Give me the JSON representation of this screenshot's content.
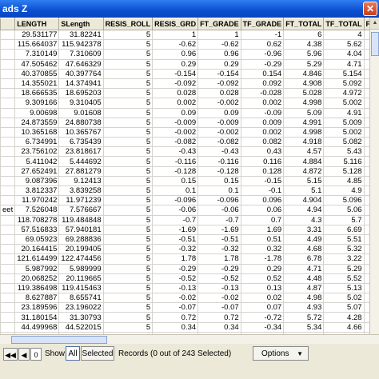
{
  "window": {
    "title": "ads Z",
    "close_glyph": "✕"
  },
  "table": {
    "columns": [
      "",
      "LENGTH",
      "SLength",
      "RESIS_ROLL",
      "RESIS_GRD",
      "FT_GRADE",
      "TF_GRADE",
      "FT_TOTAL",
      "TF_TOTAL",
      "F"
    ],
    "rows": [
      [
        "",
        "29.531177",
        "31.82241",
        "5",
        "1",
        "1",
        "-1",
        "6",
        "4",
        ""
      ],
      [
        "",
        "115.664037",
        "115.942378",
        "5",
        "-0.62",
        "-0.62",
        "0.62",
        "4.38",
        "5.62",
        ""
      ],
      [
        "",
        "7.310149",
        "7.310609",
        "5",
        "0.96",
        "0.96",
        "-0.96",
        "5.96",
        "4.04",
        ""
      ],
      [
        "",
        "47.505462",
        "47.646329",
        "5",
        "0.29",
        "0.29",
        "-0.29",
        "5.29",
        "4.71",
        ""
      ],
      [
        "",
        "40.370855",
        "40.397764",
        "5",
        "-0.154",
        "-0.154",
        "0.154",
        "4.846",
        "5.154",
        ""
      ],
      [
        "",
        "14.355021",
        "14.374941",
        "5",
        "-0.092",
        "-0.092",
        "0.092",
        "4.908",
        "5.092",
        ""
      ],
      [
        "",
        "18.666535",
        "18.695203",
        "5",
        "0.028",
        "0.028",
        "-0.028",
        "5.028",
        "4.972",
        ""
      ],
      [
        "",
        "9.309166",
        "9.310405",
        "5",
        "0.002",
        "-0.002",
        "0.002",
        "4.998",
        "5.002",
        ""
      ],
      [
        "",
        "9.00698",
        "9.01608",
        "5",
        "0.09",
        "0.09",
        "-0.09",
        "5.09",
        "4.91",
        ""
      ],
      [
        "",
        "24.873559",
        "24.880738",
        "5",
        "-0.009",
        "-0.009",
        "0.009",
        "4.991",
        "5.009",
        ""
      ],
      [
        "",
        "10.365168",
        "10.365767",
        "5",
        "-0.002",
        "-0.002",
        "0.002",
        "4.998",
        "5.002",
        ""
      ],
      [
        "",
        "6.734991",
        "6.735439",
        "5",
        "-0.082",
        "-0.082",
        "0.082",
        "4.918",
        "5.082",
        ""
      ],
      [
        "",
        "23.756102",
        "23.818617",
        "5",
        "-0.43",
        "-0.43",
        "0.43",
        "4.57",
        "5.43",
        ""
      ],
      [
        "",
        "5.411042",
        "5.444692",
        "5",
        "-0.116",
        "-0.116",
        "0.116",
        "4.884",
        "5.116",
        ""
      ],
      [
        "",
        "27.652491",
        "27.881279",
        "5",
        "-0.128",
        "-0.128",
        "0.128",
        "4.872",
        "5.128",
        ""
      ],
      [
        "",
        "9.087396",
        "9.12413",
        "5",
        "0.15",
        "0.15",
        "-0.15",
        "5.15",
        "4.85",
        ""
      ],
      [
        "",
        "3.812337",
        "3.839258",
        "5",
        "0.1",
        "0.1",
        "-0.1",
        "5.1",
        "4.9",
        ""
      ],
      [
        "",
        "11.970242",
        "11.971239",
        "5",
        "-0.096",
        "-0.096",
        "0.096",
        "4.904",
        "5.096",
        ""
      ],
      [
        "eet",
        "7.526048",
        "7.576667",
        "5",
        "-0.06",
        "-0.06",
        "0.06",
        "4.94",
        "5.06",
        ""
      ],
      [
        "",
        "118.708278",
        "119.484848",
        "5",
        "-0.7",
        "-0.7",
        "0.7",
        "4.3",
        "5.7",
        ""
      ],
      [
        "",
        "57.516833",
        "57.940181",
        "5",
        "-1.69",
        "-1.69",
        "1.69",
        "3.31",
        "6.69",
        ""
      ],
      [
        "",
        "69.05923",
        "69.288836",
        "5",
        "-0.51",
        "-0.51",
        "0.51",
        "4.49",
        "5.51",
        ""
      ],
      [
        "",
        "20.164415",
        "20.199405",
        "5",
        "-0.32",
        "-0.32",
        "0.32",
        "4.68",
        "5.32",
        ""
      ],
      [
        "",
        "121.614499",
        "122.474456",
        "5",
        "1.78",
        "1.78",
        "-1.78",
        "6.78",
        "3.22",
        ""
      ],
      [
        "",
        "5.987992",
        "5.989999",
        "5",
        "-0.29",
        "-0.29",
        "0.29",
        "4.71",
        "5.29",
        ""
      ],
      [
        "",
        "20.068252",
        "20.119665",
        "5",
        "-0.52",
        "-0.52",
        "0.52",
        "4.48",
        "5.52",
        ""
      ],
      [
        "",
        "119.386498",
        "119.415463",
        "5",
        "-0.13",
        "-0.13",
        "0.13",
        "4.87",
        "5.13",
        ""
      ],
      [
        "",
        "8.627887",
        "8.655741",
        "5",
        "-0.02",
        "-0.02",
        "0.02",
        "4.98",
        "5.02",
        ""
      ],
      [
        "",
        "23.189596",
        "23.196022",
        "5",
        "-0.07",
        "-0.07",
        "0.07",
        "4.93",
        "5.07",
        ""
      ],
      [
        "",
        "31.180154",
        "31.30793",
        "5",
        "0.72",
        "0.72",
        "-0.72",
        "5.72",
        "4.28",
        ""
      ],
      [
        "",
        "44.499968",
        "44.522015",
        "5",
        "0.34",
        "0.34",
        "-0.34",
        "5.34",
        "4.66",
        ""
      ],
      [
        "",
        "",
        "",
        "",
        "",
        "",
        "",
        "",
        "",
        ""
      ]
    ]
  },
  "status": {
    "record_number": "0",
    "show_label": "Show:",
    "all_label": "All",
    "selected_label": "Selected",
    "records_text": "Records (0 out of 243 Selected)",
    "options_label": "Options",
    "options_caret": "▼",
    "first_glyph": "◀◀",
    "prev_glyph": "◀"
  }
}
